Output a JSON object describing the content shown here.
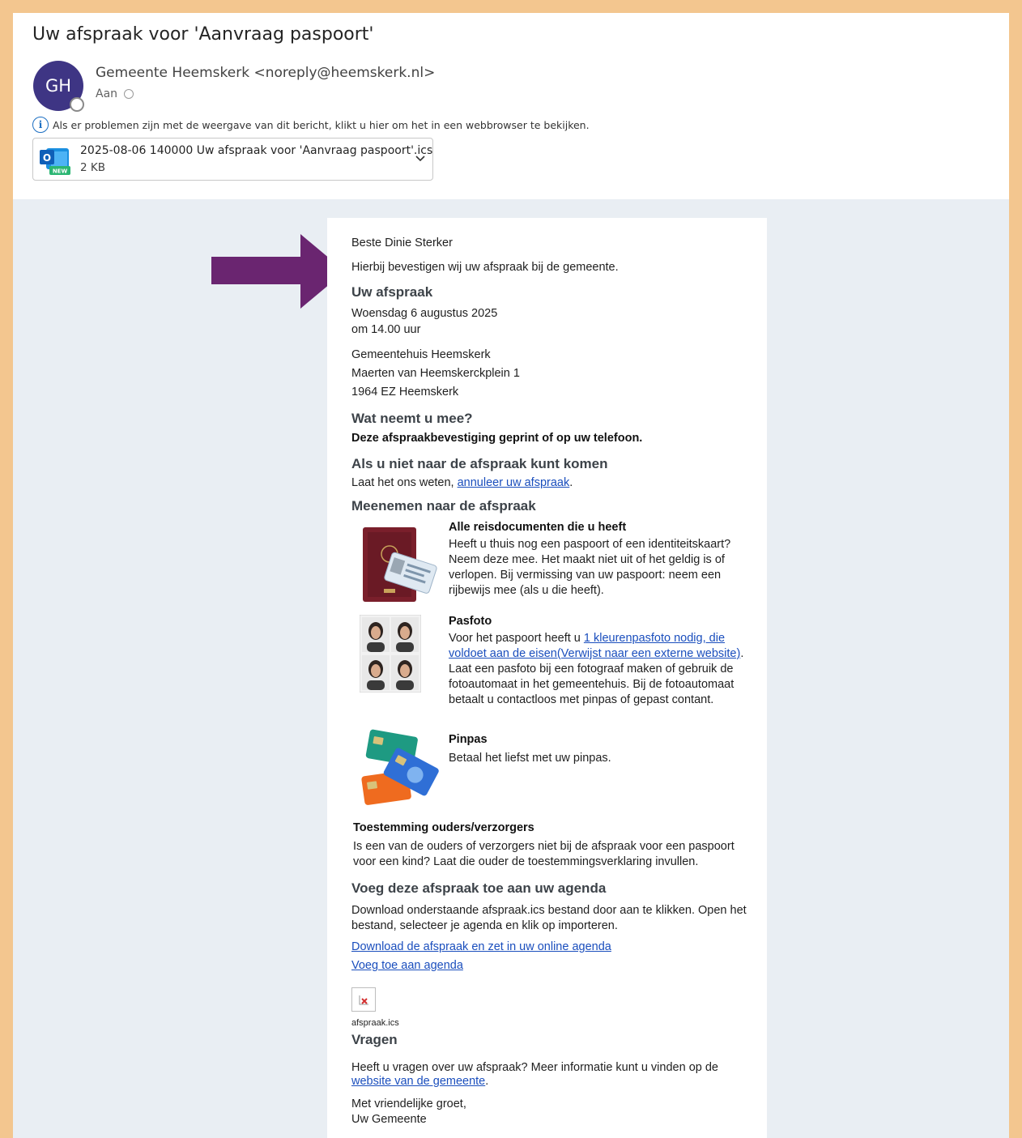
{
  "email": {
    "subject": "Uw afspraak voor 'Aanvraag paspoort'",
    "avatar_initials": "GH",
    "sender": "Gemeente Heemskerk <noreply@heemskerk.nl>",
    "to_label": "Aan",
    "info_bar": "Als er problemen zijn met de weergave van dit bericht, klikt u hier om het in een webbrowser te bekijken.",
    "attachment": {
      "name": "2025-08-06 140000 Uw afspraak voor 'Aanvraag paspoort'.ics",
      "size": "2 KB",
      "icon_badge": "NEW",
      "icon_letter": "O"
    }
  },
  "message": {
    "greeting": "Beste Dinie Sterker",
    "intro": "Hierbij bevestigen wij uw afspraak bij de gemeente.",
    "appointment_heading": "Uw afspraak",
    "date": "Woensdag 6 augustus 2025",
    "time": "om 14.00 uur",
    "location_name": "Gemeentehuis Heemskerk",
    "address_line1": "Maerten van Heemskerckplein 1",
    "address_line2": "1964 EZ Heemskerk",
    "bring_heading": "Wat neemt u mee?",
    "bring_text": "Deze afspraakbevestiging geprint of op uw telefoon.",
    "cancel_heading": "Als u niet naar de afspraak kunt komen",
    "cancel_prefix": "Laat het ons weten, ",
    "cancel_link": "annuleer uw afspraak",
    "cancel_suffix": ".",
    "take_heading": "Meenemen naar de afspraak",
    "items": [
      {
        "title": "Alle reisdocumenten die u heeft",
        "text": "Heeft u thuis nog een paspoort of een identiteitskaart? Neem deze mee. Het maakt niet uit of het geldig is of verlopen. Bij vermissing van uw paspoort: neem een rijbewijs mee (als u die heeft)."
      },
      {
        "title": "Pasfoto",
        "text_prefix": "Voor het paspoort heeft u ",
        "link": "1 kleurenpasfoto nodig, die voldoet aan de eisen(Verwijst naar een externe website)",
        "text_suffix": ". Laat een pasfoto bij een fotograaf maken of gebruik de fotoautomaat in het gemeentehuis. Bij de fotoautomaat betaalt u contactloos met pinpas of gepast contant."
      },
      {
        "title": "Pinpas",
        "text": "Betaal het liefst met uw pinpas."
      }
    ],
    "consent_heading": "Toestemming ouders/verzorgers",
    "consent_text": "Is een van de ouders of verzorgers niet bij de afspraak voor een paspoort voor een kind? Laat die ouder de toestemmingsverklaring invullen.",
    "agenda_heading": "Voeg deze afspraak toe aan uw agenda",
    "agenda_text": "Download onderstaande afspraak.ics bestand door aan te klikken. Open het bestand, selecteer je agenda en klik op importeren.",
    "agenda_link1": "Download de afspraak en zet in uw online agenda",
    "agenda_link2": "Voeg toe aan agenda",
    "ics_filename": "afspraak.ics",
    "questions_heading": "Vragen",
    "questions_prefix": "Heeft u vragen over uw afspraak? Meer informatie kunt u vinden op de ",
    "questions_link": "website van de gemeente",
    "questions_suffix": ".",
    "closing": "Met vriendelijke groet,",
    "signature": "Uw Gemeente"
  },
  "colors": {
    "frame": "#f3c68f",
    "avatar": "#3e3584",
    "arrow": "#6a2570",
    "link": "#1a4ebd",
    "body_background": "#e9eef3"
  }
}
